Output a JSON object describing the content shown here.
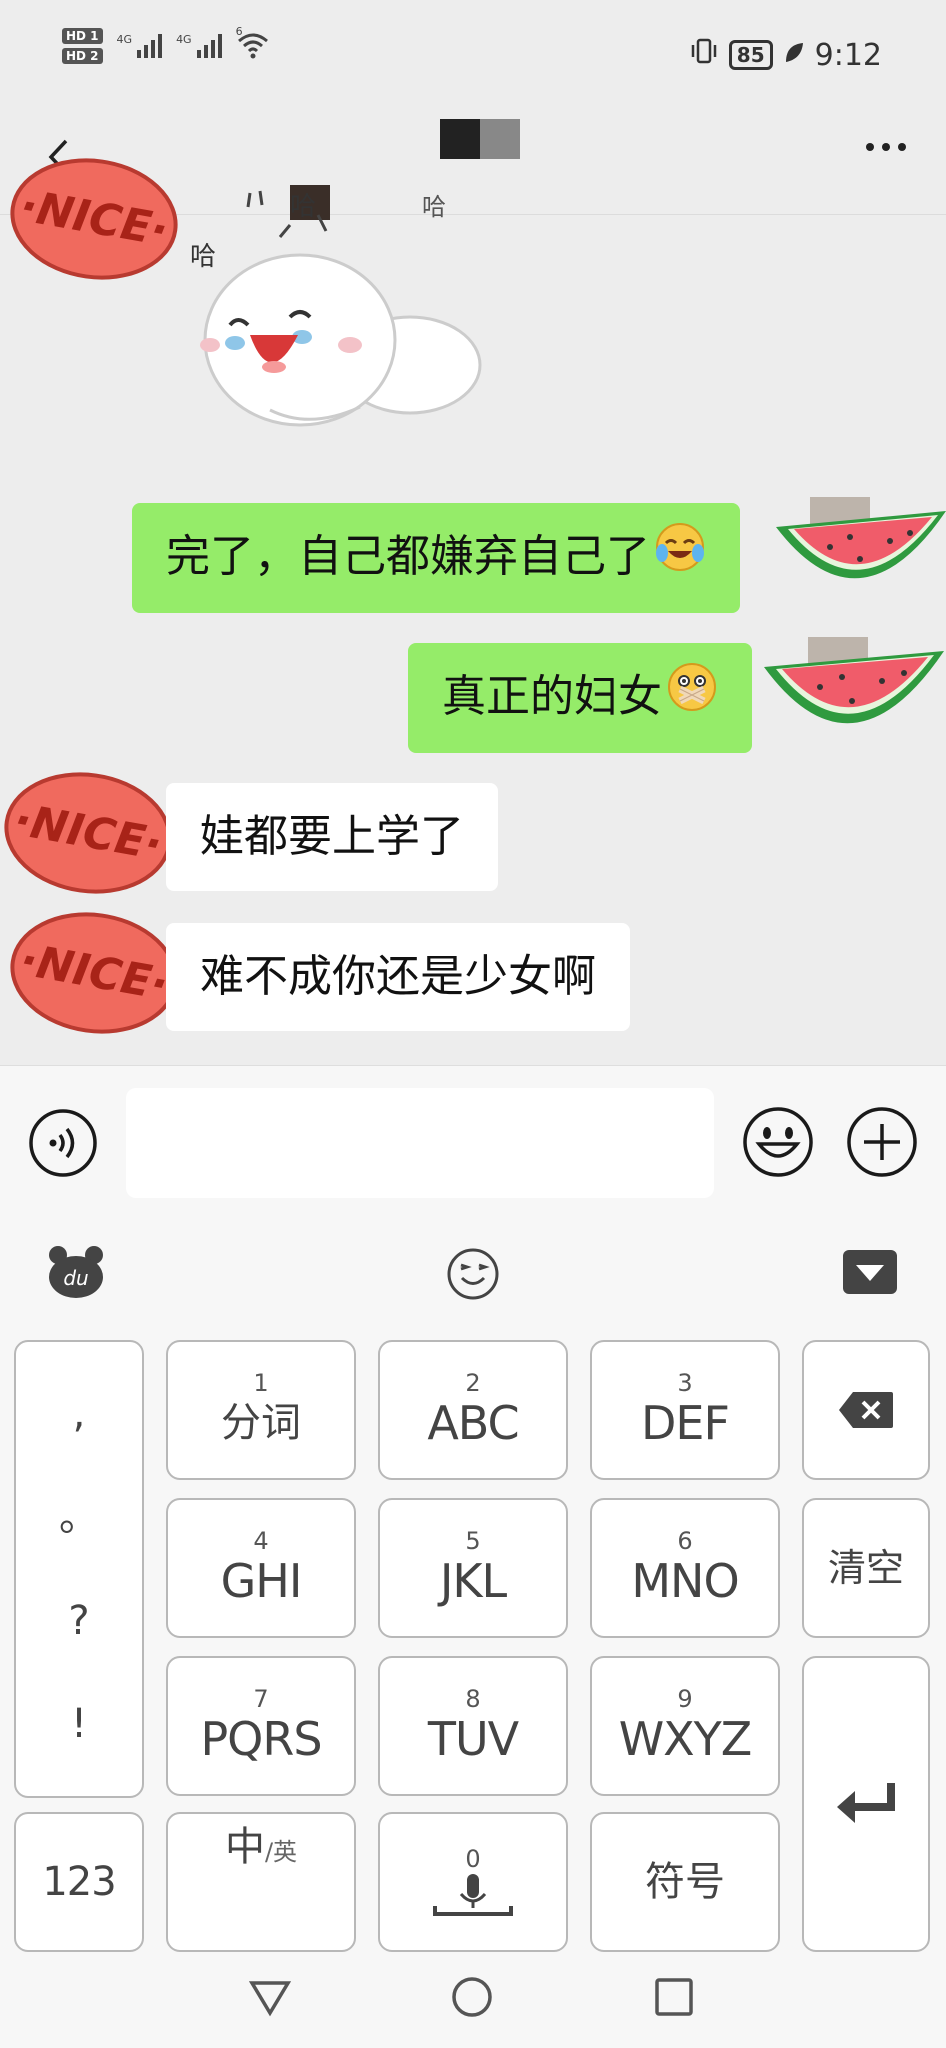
{
  "status_bar": {
    "hd1": "HD 1",
    "hd2": "HD 2",
    "sim1_network": "4G",
    "sim2_network": "4G",
    "wifi_badge": "6",
    "battery": "85",
    "time": "9:12"
  },
  "chat": {
    "sticker_text": "哈",
    "messages": [
      {
        "direction": "out",
        "text": "完了，自己都嫌弃自己了",
        "emoji": "crying-laughing-emoji"
      },
      {
        "direction": "out",
        "text": "真正的妇女",
        "emoji": "mouth-taped-emoji"
      },
      {
        "direction": "in",
        "text": "娃都要上学了"
      },
      {
        "direction": "in",
        "text": "难不成你还是少女啊"
      }
    ],
    "avatar_text": "NICE"
  },
  "input_bar": {
    "placeholder": "",
    "value": ""
  },
  "keyboard": {
    "logo_text": "du",
    "punctuation": [
      ",",
      "。",
      "?",
      "!"
    ],
    "keys": [
      {
        "num": "1",
        "label": "分词"
      },
      {
        "num": "2",
        "label": "ABC"
      },
      {
        "num": "3",
        "label": "DEF"
      },
      {
        "num": "4",
        "label": "GHI"
      },
      {
        "num": "5",
        "label": "JKL"
      },
      {
        "num": "6",
        "label": "MNO"
      },
      {
        "num": "7",
        "label": "PQRS"
      },
      {
        "num": "8",
        "label": "TUV"
      },
      {
        "num": "9",
        "label": "WXYZ"
      }
    ],
    "clear_label": "清空",
    "num_switch_label": "123",
    "lang_main": "中",
    "lang_sub": "/英",
    "zero_label": "0",
    "symbols_label": "符号"
  },
  "colors": {
    "outgoing_bubble": "#95ec69",
    "incoming_bubble": "#ffffff",
    "background": "#ededed",
    "nice_red": "#f06a5e"
  }
}
